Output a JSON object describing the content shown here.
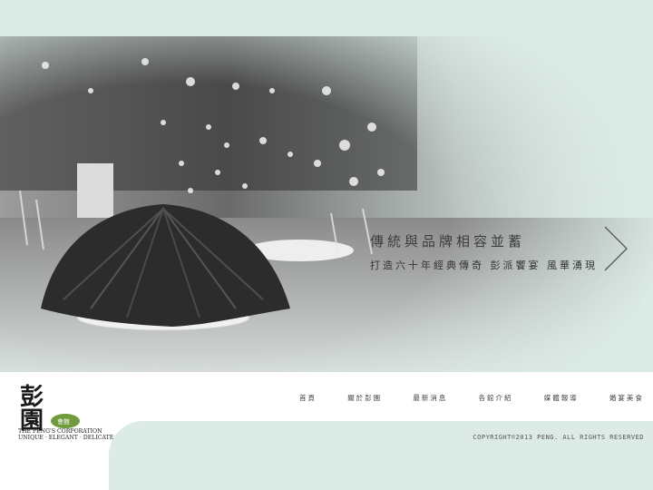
{
  "hero": {
    "title": "傳統與品牌相容並蓄",
    "subtitle": "打造六十年經典傳奇  彭派饗宴  風華湧現",
    "next_icon": "chevron-right-icon"
  },
  "logo": {
    "chars": "彭園",
    "badge": "會館",
    "company": "THE PENG'S CORPORATION",
    "motto": "UNIQUE · ELEGANT · DELICATE"
  },
  "nav": {
    "items": [
      {
        "label": "首頁"
      },
      {
        "label": "關於彭園"
      },
      {
        "label": "最新消息"
      },
      {
        "label": "各館介紹"
      },
      {
        "label": "媒體報導"
      },
      {
        "label": "婚宴美食"
      }
    ]
  },
  "footer": {
    "copyright": "COPYRIGHT©2013 PENG. ALL RIGHTS RESERVED"
  },
  "colors": {
    "background": "#dcebe6",
    "footer": "#ffffff",
    "logo_badge": "#6e9c3c"
  }
}
